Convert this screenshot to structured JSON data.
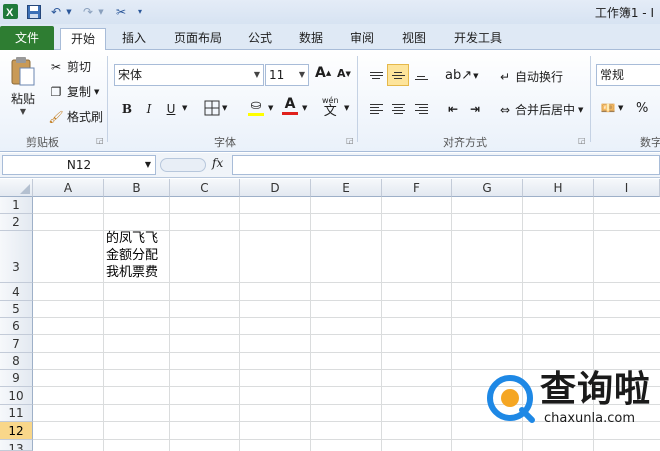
{
  "window": {
    "title": "工作簿1 - I"
  },
  "tabs": [
    {
      "label": "文件"
    },
    {
      "label": "开始"
    },
    {
      "label": "插入"
    },
    {
      "label": "页面布局"
    },
    {
      "label": "公式"
    },
    {
      "label": "数据"
    },
    {
      "label": "审阅"
    },
    {
      "label": "视图"
    },
    {
      "label": "开发工具"
    }
  ],
  "clipboard": {
    "paste": "粘贴",
    "cut": "剪切",
    "copy": "复制",
    "format_painter": "格式刷",
    "group": "剪贴板"
  },
  "font": {
    "name": "宋体",
    "size": "11",
    "group": "字体",
    "bold": "B",
    "italic": "I",
    "underline": "U",
    "grow": "A",
    "shrink": "A",
    "font_color": "A",
    "wen": "wén"
  },
  "alignment": {
    "wrap": "自动换行",
    "merge": "合并后居中",
    "group": "对齐方式"
  },
  "number": {
    "format": "常规",
    "percent": "%",
    "group": "数字"
  },
  "formula_bar": {
    "name_box": "N12",
    "fx": "fx",
    "content": ""
  },
  "columns": [
    "A",
    "B",
    "C",
    "D",
    "E",
    "F",
    "G",
    "H",
    "I"
  ],
  "rows": [
    "1",
    "2",
    "3",
    "4",
    "5",
    "6",
    "7",
    "8",
    "9",
    "10",
    "11",
    "12",
    "13"
  ],
  "selected_row": "12",
  "cell_b3": {
    "lines": [
      "的凤飞飞",
      "金额分配",
      "我机票费"
    ]
  },
  "watermark": {
    "text": "查询啦",
    "url": "chaxunla.com"
  },
  "colors": {
    "file_tab": "#2e7d32",
    "selection": "#f9d78a",
    "logo_blue": "#1e88e5"
  }
}
